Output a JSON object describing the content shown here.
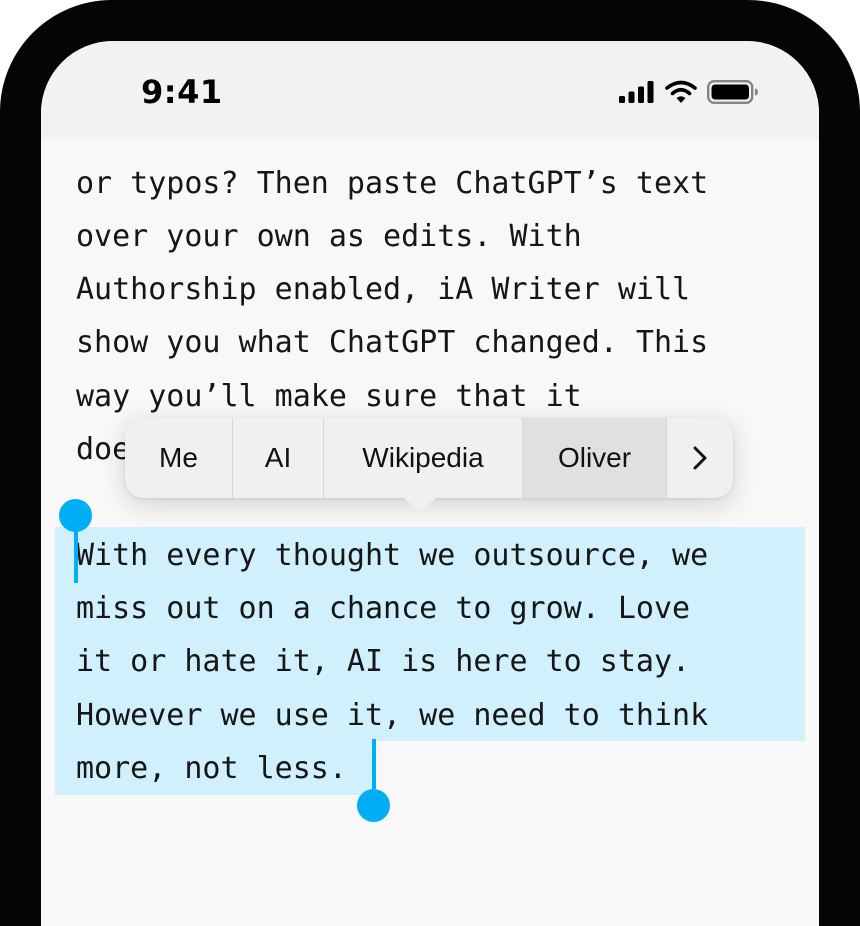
{
  "status_bar": {
    "time": "9:41",
    "icons": [
      "cellular-signal-icon",
      "wifi-icon",
      "battery-icon"
    ]
  },
  "document": {
    "paragraph_1_lines": [
      "or typos? Then paste ChatGPT’s text",
      "over your own as edits. With",
      "Authorship enabled, iA Writer will",
      "show you what ChatGPT changed. This",
      "way you’ll make sure that it",
      "doe"
    ],
    "paragraph_2_lines": [
      "With every thought we outsource, we",
      "miss out on a chance to grow. Love",
      "it or hate it, AI is here to stay.",
      "However we use it, we need to think",
      "more, not less."
    ]
  },
  "context_menu": {
    "items": [
      "Me",
      "AI",
      "Wikipedia",
      "Oliver"
    ],
    "selected": "Oliver",
    "more_icon": "chevron-right-icon"
  },
  "colors": {
    "selection": "#cff0fc",
    "handle": "#00aef5",
    "menu_background": "#f0f0f0"
  }
}
